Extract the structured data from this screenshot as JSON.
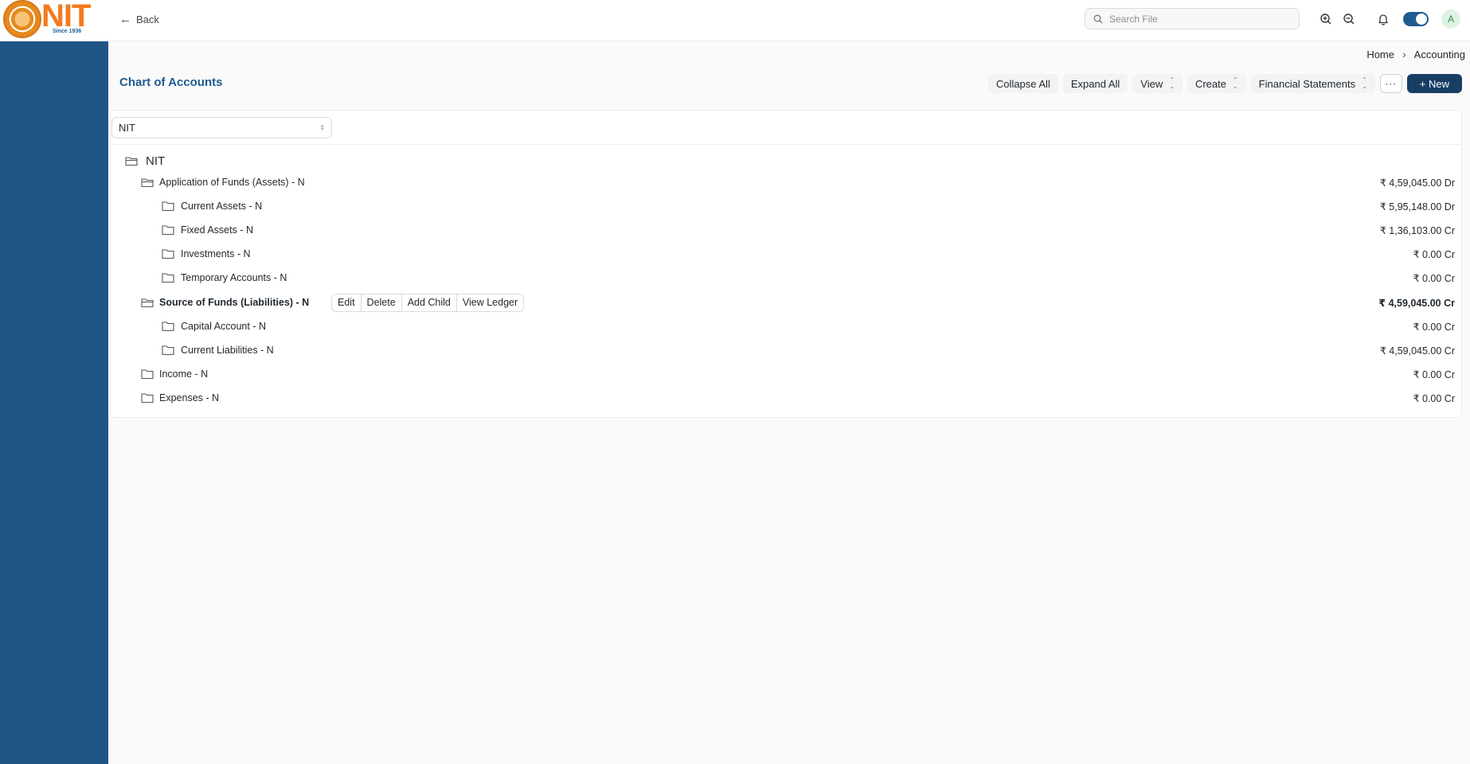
{
  "brand": {
    "logo_text": "NIT",
    "logo_since": "Since 1936"
  },
  "topbar": {
    "back_label": "Back",
    "search_placeholder": "Search File",
    "avatar_initial": "A"
  },
  "breadcrumb": {
    "home": "Home",
    "current": "Accounting"
  },
  "page": {
    "title": "Chart of Accounts"
  },
  "toolbar": {
    "collapse_all": "Collapse All",
    "expand_all": "Expand All",
    "view": "View",
    "create": "Create",
    "financial_statements": "Financial Statements",
    "more": "···",
    "new": "+ New"
  },
  "filter": {
    "company": "NIT"
  },
  "tree": {
    "root": {
      "label": "NIT"
    },
    "rows": [
      {
        "label": "Application of Funds (Assets) - N",
        "amount": "₹ 4,59,045.00 Dr"
      },
      {
        "label": "Current Assets - N",
        "amount": "₹ 5,95,148.00 Dr"
      },
      {
        "label": "Fixed Assets - N",
        "amount": "₹ 1,36,103.00 Cr"
      },
      {
        "label": "Investments - N",
        "amount": "₹ 0.00 Cr"
      },
      {
        "label": "Temporary Accounts - N",
        "amount": "₹ 0.00 Cr"
      },
      {
        "label": "Source of Funds (Liabilities) - N",
        "amount": "₹ 4,59,045.00 Cr"
      },
      {
        "label": "Capital Account - N",
        "amount": "₹ 0.00 Cr"
      },
      {
        "label": "Current Liabilities - N",
        "amount": "₹ 4,59,045.00 Cr"
      },
      {
        "label": "Income - N",
        "amount": "₹ 0.00 Cr"
      },
      {
        "label": "Expenses - N",
        "amount": "₹ 0.00 Cr"
      }
    ],
    "row_actions": {
      "edit": "Edit",
      "delete": "Delete",
      "add_child": "Add Child",
      "view_ledger": "View Ledger"
    }
  },
  "colors": {
    "primary": "#1e5b91",
    "sidebar": "#1e5585",
    "button_primary": "#183e66",
    "logo_orange": "#f47a1f"
  }
}
